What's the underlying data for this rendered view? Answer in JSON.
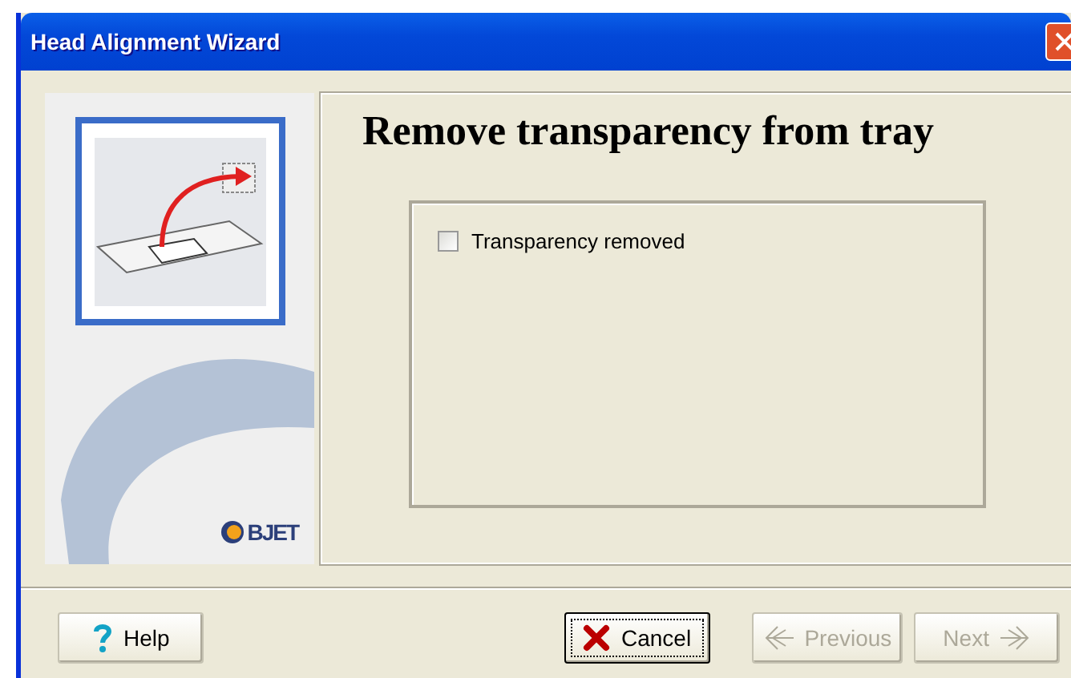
{
  "window": {
    "title": "Head Alignment Wizard"
  },
  "sidebar": {
    "logo_text": "BJET"
  },
  "page": {
    "heading": "Remove transparency from tray",
    "checkbox": {
      "label": "Transparency removed",
      "checked": false
    }
  },
  "buttons": [
    {
      "label": "Help",
      "kind": "help",
      "disabled": false,
      "focused": false
    },
    {
      "label": "Cancel",
      "kind": "cancel",
      "disabled": false,
      "focused": true
    },
    {
      "label": "Previous",
      "kind": "previous",
      "disabled": true,
      "focused": false
    },
    {
      "label": "Next",
      "kind": "next",
      "disabled": true,
      "focused": false
    }
  ]
}
